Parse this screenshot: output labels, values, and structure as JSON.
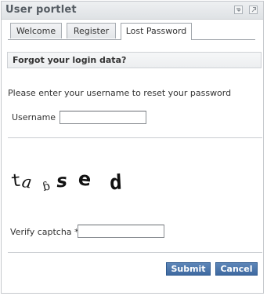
{
  "portlet": {
    "title": "User portlet"
  },
  "tabs": [
    {
      "label": "Welcome"
    },
    {
      "label": "Register"
    },
    {
      "label": "Lost Password",
      "active": true
    }
  ],
  "section": {
    "heading": "Forgot your login data?"
  },
  "form": {
    "intro": "Please enter your username to reset your password",
    "username_label": "Username",
    "username_value": "",
    "captcha_text": "taɓsed",
    "captcha_label": "Verify captcha *",
    "captcha_value": "",
    "submit_label": "Submit",
    "cancel_label": "Cancel"
  },
  "colors": {
    "button": "#4a74a9",
    "title_text": "#555c63"
  },
  "icons": {
    "minimize": "minimize-icon",
    "maximize": "maximize-icon"
  }
}
